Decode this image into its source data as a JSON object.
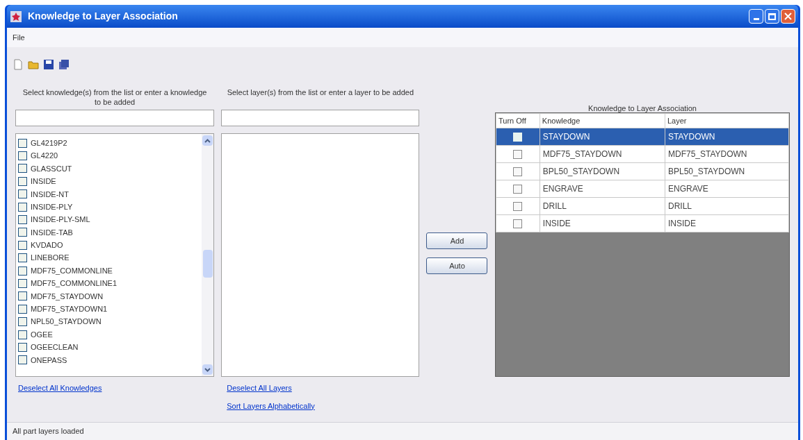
{
  "window": {
    "title": "Knowledge to Layer Association"
  },
  "menu": [
    "File"
  ],
  "knowledge_panel": {
    "label": "Select knowledge(s) from the list or enter a knowledge to be added",
    "items": [
      {
        "label": "GL4219P2",
        "checked": false
      },
      {
        "label": "GL4220",
        "checked": false
      },
      {
        "label": "GLASSCUT",
        "checked": false
      },
      {
        "label": "INSIDE",
        "checked": false
      },
      {
        "label": "INSIDE-NT",
        "checked": false
      },
      {
        "label": "INSIDE-PLY",
        "checked": false
      },
      {
        "label": "INSIDE-PLY-SML",
        "checked": false
      },
      {
        "label": "INSIDE-TAB",
        "checked": false
      },
      {
        "label": "KVDADO",
        "checked": false
      },
      {
        "label": "LINEBORE",
        "checked": false
      },
      {
        "label": "MDF75_COMMONLINE",
        "checked": false
      },
      {
        "label": "MDF75_COMMONLINE1",
        "checked": false
      },
      {
        "label": "MDF75_STAYDOWN",
        "checked": false
      },
      {
        "label": "MDF75_STAYDOWN1",
        "checked": false
      },
      {
        "label": "NPL50_STAYDOWN",
        "checked": false
      },
      {
        "label": "OGEE",
        "checked": false
      },
      {
        "label": "OGEECLEAN",
        "checked": false
      },
      {
        "label": "ONEPASS",
        "checked": false
      }
    ],
    "links": [
      "Deselect All Knowledges"
    ]
  },
  "layer_panel": {
    "label": "Select layer(s) from the list or enter a layer to be added",
    "links": [
      "Deselect All Layers",
      "Sort Layers Alphabetically"
    ]
  },
  "buttons": [
    "Add",
    "Auto"
  ],
  "association": {
    "title": "Knowledge to Layer Association",
    "columns": [
      "Turn Off",
      "Knowledge",
      "Layer"
    ],
    "rows": [
      {
        "turn_off": false,
        "knowledge": "STAYDOWN",
        "layer": "STAYDOWN",
        "selected": true
      },
      {
        "turn_off": false,
        "knowledge": "MDF75_STAYDOWN",
        "layer": "MDF75_STAYDOWN",
        "selected": false
      },
      {
        "turn_off": false,
        "knowledge": "BPL50_STAYDOWN",
        "layer": "BPL50_STAYDOWN",
        "selected": false
      },
      {
        "turn_off": false,
        "knowledge": "ENGRAVE",
        "layer": "ENGRAVE",
        "selected": false
      },
      {
        "turn_off": false,
        "knowledge": "DRILL",
        "layer": "DRILL",
        "selected": false
      },
      {
        "turn_off": false,
        "knowledge": "INSIDE",
        "layer": "INSIDE",
        "selected": false
      }
    ]
  },
  "status_bar": "All part layers loaded"
}
